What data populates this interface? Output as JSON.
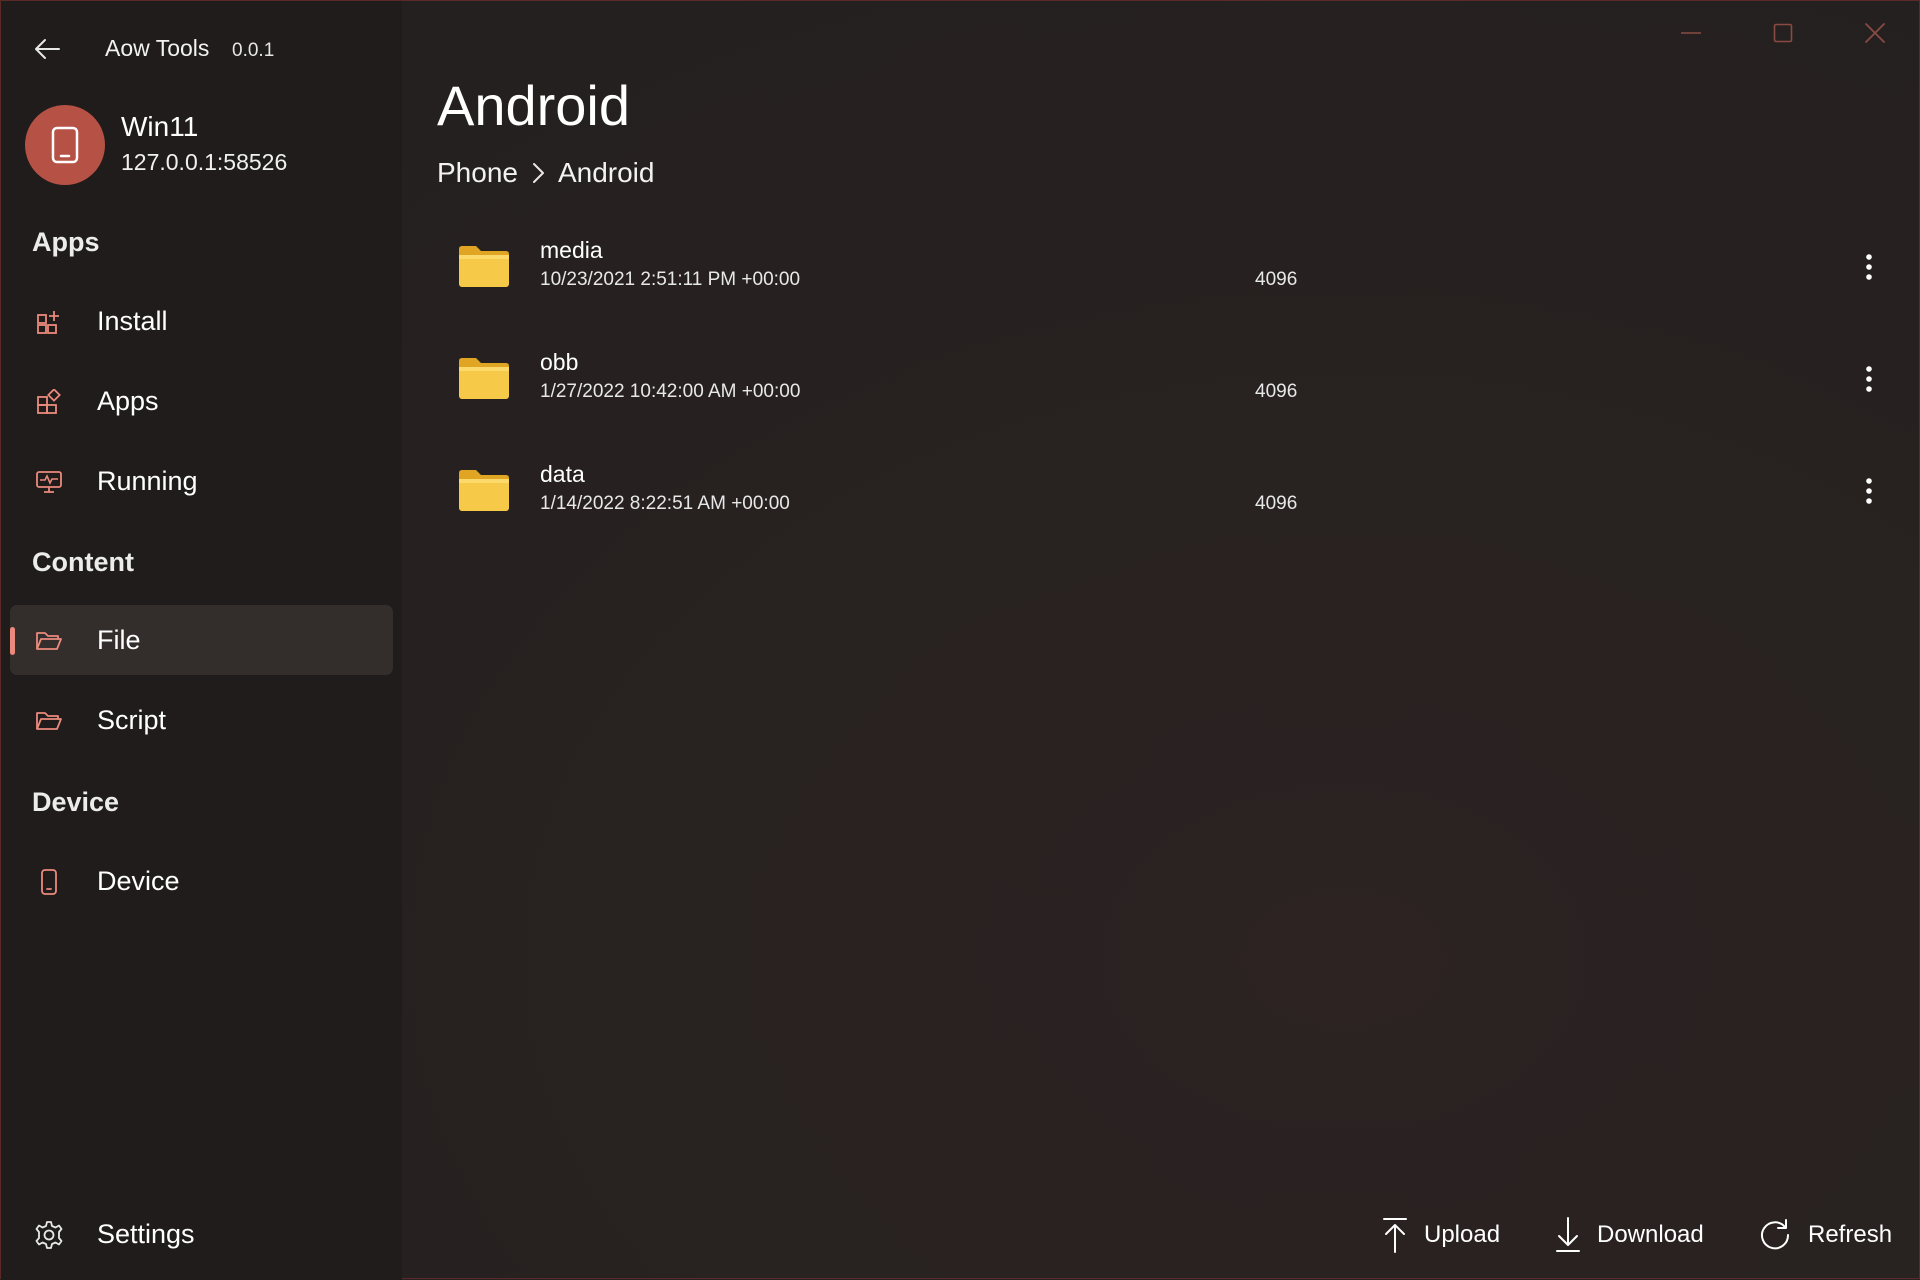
{
  "app": {
    "title": "Aow Tools",
    "version": "0.0.1",
    "accent": "#ea8a7c",
    "avatar_color": "#b65146",
    "folder_color": "#f7c948"
  },
  "device": {
    "name": "Win11",
    "address": "127.0.0.1:58526"
  },
  "sidebar": {
    "sections": [
      {
        "header": "Apps",
        "items": [
          {
            "label": "Install",
            "icon": "grid-add-icon"
          },
          {
            "label": "Apps",
            "icon": "apps-grid-icon"
          },
          {
            "label": "Running",
            "icon": "monitor-pulse-icon"
          }
        ]
      },
      {
        "header": "Content",
        "items": [
          {
            "label": "File",
            "icon": "folder-open-icon",
            "selected": true
          },
          {
            "label": "Script",
            "icon": "folder-open-icon"
          }
        ]
      },
      {
        "header": "Device",
        "items": [
          {
            "label": "Device",
            "icon": "phone-icon"
          }
        ]
      }
    ],
    "settings_label": "Settings"
  },
  "main": {
    "title": "Android",
    "breadcrumb": [
      "Phone",
      "Android"
    ],
    "files": [
      {
        "name": "media",
        "date": "10/23/2021 2:51:11 PM +00:00",
        "size": "4096"
      },
      {
        "name": "obb",
        "date": "1/27/2022 10:42:00 AM +00:00",
        "size": "4096"
      },
      {
        "name": "data",
        "date": "1/14/2022 8:22:51 AM +00:00",
        "size": "4096"
      }
    ],
    "actions": {
      "upload": "Upload",
      "download": "Download",
      "refresh": "Refresh"
    }
  }
}
